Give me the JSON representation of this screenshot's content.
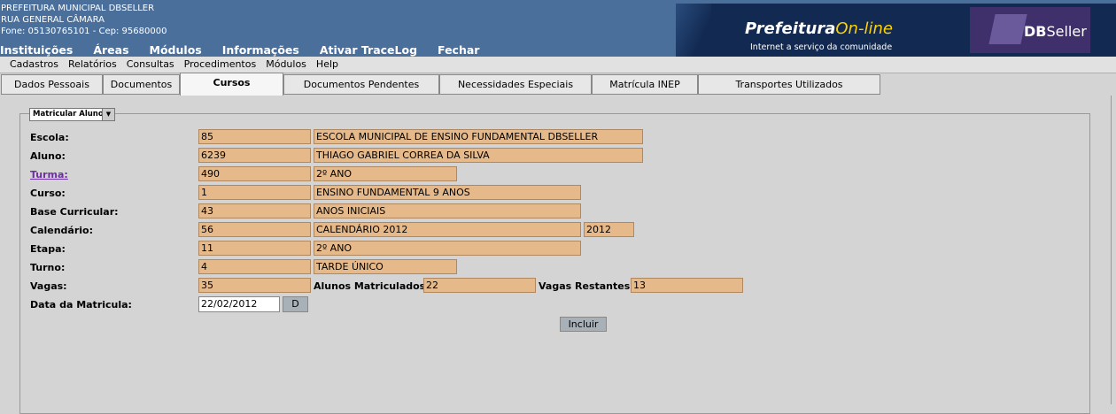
{
  "header": {
    "line1": "PREFEITURA MUNICIPAL DBSELLER",
    "line2": "RUA GENERAL CÂMARA",
    "line3": "Fone: 05130765101  -  Cep: 95680000",
    "menu": [
      "Instituições",
      "Áreas",
      "Módulos",
      "Informações",
      "Ativar TraceLog",
      "Fechar"
    ],
    "banner_brand": "Prefeitura",
    "banner_brand_suffix": "On-line",
    "banner_sub": "Internet a serviço da comunidade",
    "db_logo_a": "DB",
    "db_logo_b": "Seller"
  },
  "menubar": [
    "Cadastros",
    "Relatórios",
    "Consultas",
    "Procedimentos",
    "Módulos",
    "Help"
  ],
  "tabs": [
    "Dados Pessoais",
    "Documentos",
    "Cursos",
    "Documentos Pendentes",
    "Necessidades Especiais",
    "Matrícula INEP",
    "Transportes Utilizados"
  ],
  "active_tab": "Cursos",
  "form": {
    "select_value": "Matricular Aluno",
    "escola_label": "Escola:",
    "escola_code": "85",
    "escola_name": "ESCOLA MUNICIPAL DE ENSINO FUNDAMENTAL DBSELLER",
    "aluno_label": "Aluno:",
    "aluno_code": "6239",
    "aluno_name": "THIAGO GABRIEL CORREA DA SILVA",
    "turma_label": "Turma:",
    "turma_code": "490",
    "turma_name": "2º ANO",
    "curso_label": "Curso:",
    "curso_code": "1",
    "curso_name": "ENSINO FUNDAMENTAL 9 ANOS",
    "base_label": "Base Curricular:",
    "base_code": "43",
    "base_name": "ANOS INICIAIS",
    "calendario_label": "Calendário:",
    "calendario_code": "56",
    "calendario_name": "CALENDÁRIO 2012",
    "calendario_year": "2012",
    "etapa_label": "Etapa:",
    "etapa_code": "11",
    "etapa_name": "2º ANO",
    "turno_label": "Turno:",
    "turno_code": "4",
    "turno_name": "TARDE ÚNICO",
    "vagas_label": "Vagas:",
    "vagas_value": "35",
    "alunos_matriculados_label": "Alunos Matriculados:",
    "alunos_matriculados_value": "22",
    "vagas_restantes_label": "Vagas Restantes:",
    "vagas_restantes_value": "13",
    "data_label": "Data da Matricula:",
    "data_value": "22/02/2012",
    "date_button": "D",
    "incluir_button": "Incluir"
  },
  "colors": {
    "header_bg": "#4a6f9b",
    "field_bg": "#e6b98a",
    "panel_bg": "#d4d4d4"
  }
}
